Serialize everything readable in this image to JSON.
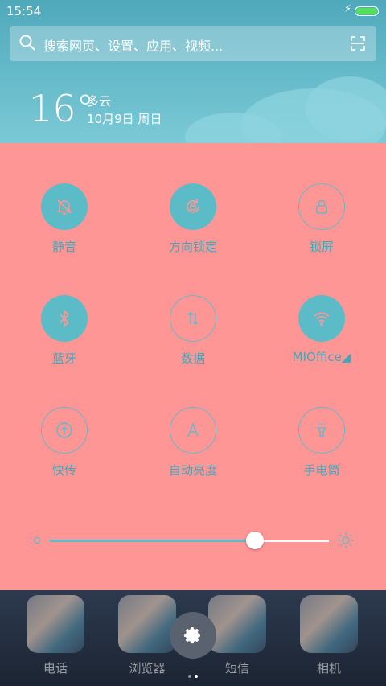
{
  "status": {
    "time": "15:54"
  },
  "search": {
    "placeholder": "搜索网页、设置、应用、视频..."
  },
  "weather": {
    "temperature": "16°",
    "condition": "多云",
    "date": "10月9日 周日"
  },
  "toggles": [
    {
      "label": "静音",
      "icon": "bell-off-icon",
      "on": true
    },
    {
      "label": "方向锁定",
      "icon": "rotation-lock-icon",
      "on": true
    },
    {
      "label": "锁屏",
      "icon": "lock-icon",
      "on": false
    },
    {
      "label": "蓝牙",
      "icon": "bluetooth-icon",
      "on": true
    },
    {
      "label": "数据",
      "icon": "data-arrows-icon",
      "on": false
    },
    {
      "label": "MIOffice◢",
      "icon": "wifi-icon",
      "on": true
    },
    {
      "label": "快传",
      "icon": "quick-transfer-icon",
      "on": false
    },
    {
      "label": "自动亮度",
      "icon": "auto-brightness-icon",
      "on": false
    },
    {
      "label": "手电筒",
      "icon": "flashlight-icon",
      "on": false
    }
  ],
  "brightness": {
    "level": 0.73
  },
  "dock": {
    "apps": [
      "电话",
      "浏览器",
      "短信",
      "相机"
    ]
  },
  "colors": {
    "panel": "#ff9696",
    "accent": "#5bbcc8",
    "header": "#5fb8c9"
  }
}
